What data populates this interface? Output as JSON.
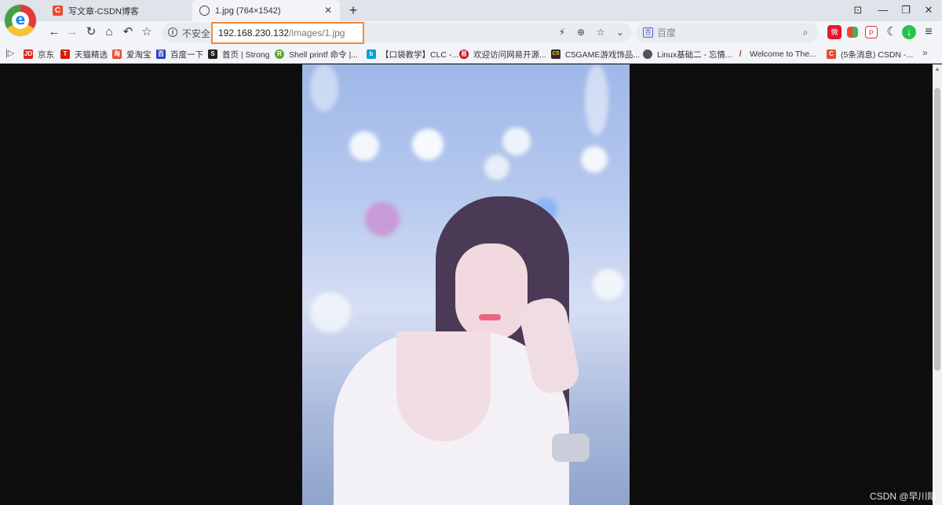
{
  "tabs": [
    {
      "title": "写文章-CSDN博客",
      "active": false,
      "favicon": "csdn-c-icon",
      "favicon_text": "C"
    },
    {
      "title": "1.jpg (764×1542)",
      "active": true,
      "favicon": "globe-icon"
    }
  ],
  "tab_close_glyph": "✕",
  "new_tab_glyph": "+",
  "window_controls": [
    "⊡",
    "—",
    "❐",
    "✕"
  ],
  "nav": {
    "back": "←",
    "forward": "→",
    "reload": "↻",
    "home": "⌂",
    "undo": "↶",
    "star": "☆"
  },
  "address": {
    "info_glyph": "i",
    "security_label": "不安全",
    "url_host": "192.168.230.132",
    "url_path": "/images/1.jpg"
  },
  "address_icons": {
    "bolt": "⚡",
    "zoom": "⊕",
    "bookmark": "☆",
    "dropdown": "⌄"
  },
  "search": {
    "engine_glyph": "百",
    "placeholder": "百度",
    "icon": "⌕"
  },
  "extensions": [
    "weibo-icon",
    "apps-icon",
    "pdf-icon",
    "moon-icon",
    "download-icon",
    "menu-icon"
  ],
  "ext_glyphs": {
    "weibo": "微",
    "pdf": "P",
    "moon": "☾",
    "download": "↓",
    "menu": "≡"
  },
  "bookmarks": [
    {
      "label": "京东",
      "icon": "jd-icon",
      "icon_text": "JD",
      "color": "#e1251b"
    },
    {
      "label": "天猫精选",
      "icon": "tmall-icon",
      "icon_text": "T",
      "color": "#d81e06"
    },
    {
      "label": "爱淘宝",
      "icon": "taobao-icon",
      "icon_text": "淘",
      "color": "#e94b2c"
    },
    {
      "label": "百度一下",
      "icon": "baidu-paw-icon",
      "icon_text": "百",
      "color": "#2f3fbf"
    },
    {
      "label": "首页 | Strong",
      "icon": "strong-icon",
      "icon_text": "S",
      "color": "#222222"
    },
    {
      "label": "Shell printf 命令 |...",
      "icon": "runoob-icon",
      "icon_text": "R",
      "color": "#5fa833"
    },
    {
      "label": "【口袋教学】CLC -...",
      "icon": "bilibili-icon",
      "icon_text": "b",
      "color": "#00a1d6"
    },
    {
      "label": "欢迎访问网易开源...",
      "icon": "netease-icon",
      "icon_text": "易",
      "color": "#d0021b"
    },
    {
      "label": "C5GAME游戏饰品...",
      "icon": "c5game-icon",
      "icon_text": "C5",
      "color": "#2b2b2b"
    },
    {
      "label": "Linux基础二 - 忘情...",
      "icon": "globe-icon",
      "icon_text": "",
      "color": "#555555"
    },
    {
      "label": "Welcome to The...",
      "icon": "feather-icon",
      "icon_text": "/",
      "color": "#c0392b"
    },
    {
      "label": "(5条消息) CSDN -...",
      "icon": "csdn-c-icon",
      "icon_text": "C",
      "color": "#ea4b30"
    }
  ],
  "bookmarks_more": "»",
  "bookmarks_toggle": "|▷",
  "watermark": "CSDN @早川睛",
  "colors": {
    "page_bg": "#0e0e0e",
    "address_highlight": "#ef8a3c",
    "csdn": "#ea4b30"
  }
}
